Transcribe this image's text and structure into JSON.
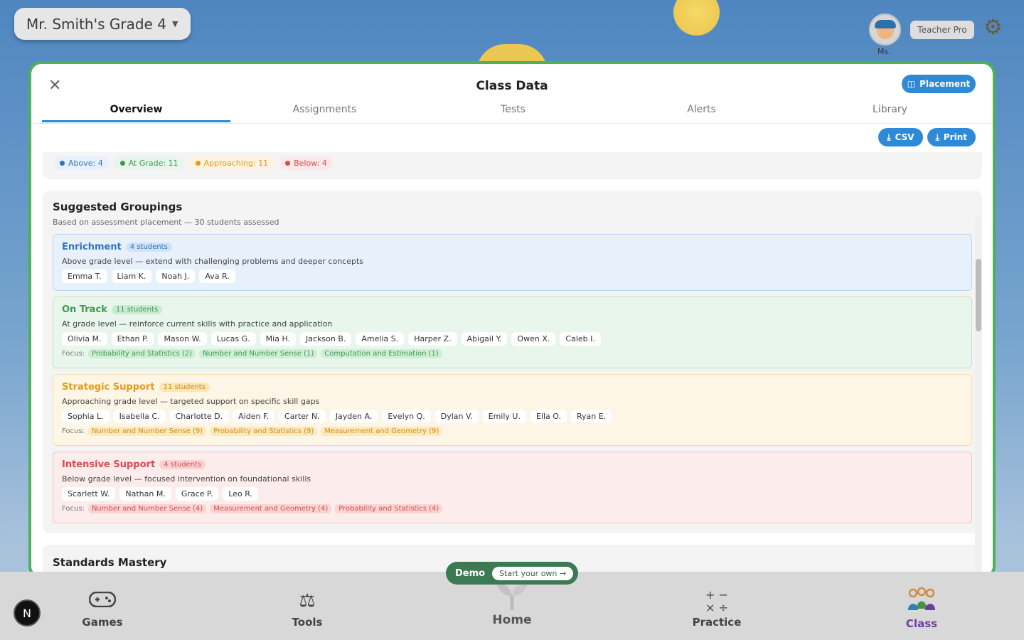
{
  "topbar": {
    "class_name": "Mr. Smith's Grade 4",
    "avatar_label": "Ms.",
    "pro_badge": "Teacher Pro"
  },
  "modal": {
    "title": "Class Data",
    "placement_label": "Placement",
    "tabs": [
      {
        "label": "Overview",
        "active": true
      },
      {
        "label": "Assignments",
        "active": false
      },
      {
        "label": "Tests",
        "active": false
      },
      {
        "label": "Alerts",
        "active": false
      },
      {
        "label": "Library",
        "active": false
      }
    ],
    "csv_label": "CSV",
    "print_label": "Print"
  },
  "summary": {
    "above": "Above: 4",
    "at_grade": "At Grade: 11",
    "approaching": "Approaching: 11",
    "below": "Below: 4"
  },
  "groupings": {
    "title": "Suggested Groupings",
    "subtitle": "Based on assessment placement — 30 students assessed",
    "focus_label": "Focus:",
    "groups": [
      {
        "name": "Enrichment",
        "count": "4 students",
        "description": "Above grade level — extend with challenging problems and deeper concepts",
        "students": [
          "Emma T.",
          "Liam K.",
          "Noah J.",
          "Ava R."
        ],
        "focus": []
      },
      {
        "name": "On Track",
        "count": "11 students",
        "description": "At grade level — reinforce current skills with practice and application",
        "students": [
          "Olivia M.",
          "Ethan P.",
          "Mason W.",
          "Lucas G.",
          "Mia H.",
          "Jackson B.",
          "Amelia S.",
          "Harper Z.",
          "Abigail Y.",
          "Owen X.",
          "Caleb I."
        ],
        "focus": [
          "Probability and Statistics (2)",
          "Number and Number Sense (1)",
          "Computation and Estimation (1)"
        ]
      },
      {
        "name": "Strategic Support",
        "count": "11 students",
        "description": "Approaching grade level — targeted support on specific skill gaps",
        "students": [
          "Sophia L.",
          "Isabella C.",
          "Charlotte D.",
          "Aiden F.",
          "Carter N.",
          "Jayden A.",
          "Evelyn Q.",
          "Dylan V.",
          "Emily U.",
          "Ella O.",
          "Ryan E."
        ],
        "focus": [
          "Number and Number Sense (9)",
          "Probability and Statistics (9)",
          "Measurement and Geometry (9)"
        ]
      },
      {
        "name": "Intensive Support",
        "count": "4 students",
        "description": "Below grade level — focused intervention on foundational skills",
        "students": [
          "Scarlett W.",
          "Nathan M.",
          "Grace P.",
          "Leo R."
        ],
        "focus": [
          "Number and Number Sense (4)",
          "Measurement and Geometry (4)",
          "Probability and Statistics (4)"
        ]
      }
    ]
  },
  "mastery": {
    "title": "Standards Mastery"
  },
  "demo": {
    "label": "Demo",
    "cta": "Start your own →"
  },
  "nav": {
    "games": "Games",
    "tools": "Tools",
    "home": "Home",
    "practice": "Practice",
    "class": "Class",
    "logo": "N"
  },
  "colors": {
    "accent": "#2e8ad6",
    "modal_border": "#4fb05a",
    "enrichment": "#2e74c0",
    "on_track": "#3a9a4e",
    "strategic": "#e69a1a",
    "intensive": "#d94b4b"
  }
}
